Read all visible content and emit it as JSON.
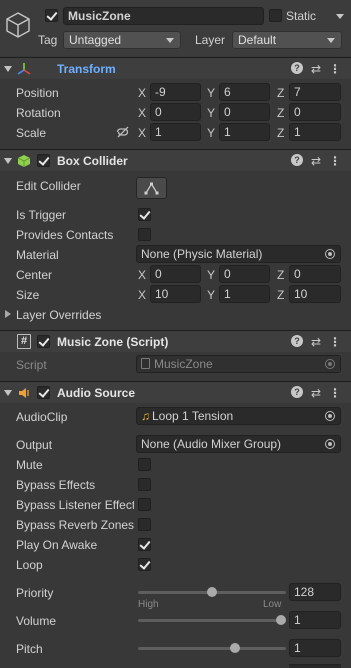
{
  "go": {
    "name": "MusicZone",
    "static_label": "Static",
    "tag_label": "Tag",
    "tag_value": "Untagged",
    "layer_label": "Layer",
    "layer_value": "Default"
  },
  "transform": {
    "title": "Transform",
    "rows": [
      {
        "label": "Position",
        "x": "-9",
        "y": "6",
        "z": "7"
      },
      {
        "label": "Rotation",
        "x": "0",
        "y": "0",
        "z": "0"
      },
      {
        "label": "Scale",
        "x": "1",
        "y": "1",
        "z": "1"
      }
    ]
  },
  "axes": {
    "x": "X",
    "y": "Y",
    "z": "Z"
  },
  "box_collider": {
    "title": "Box Collider",
    "edit_label": "Edit Collider",
    "is_trigger_label": "Is Trigger",
    "provides_contacts_label": "Provides Contacts",
    "material_label": "Material",
    "material_value": "None (Physic Material)",
    "center_label": "Center",
    "center": {
      "x": "0",
      "y": "0",
      "z": "0"
    },
    "size_label": "Size",
    "size": {
      "x": "10",
      "y": "1",
      "z": "10"
    },
    "layer_overrides_label": "Layer Overrides"
  },
  "script": {
    "title": "Music Zone (Script)",
    "label": "Script",
    "value": "MusicZone"
  },
  "audio": {
    "title": "Audio Source",
    "clip_label": "AudioClip",
    "clip_value": "Loop 1 Tension",
    "output_label": "Output",
    "output_value": "None (Audio Mixer Group)",
    "mute_label": "Mute",
    "bypass_effects_label": "Bypass Effects",
    "bypass_listener_label": "Bypass Listener Effects",
    "bypass_reverb_label": "Bypass Reverb Zones",
    "play_on_awake_label": "Play On Awake",
    "loop_label": "Loop",
    "priority_label": "Priority",
    "priority_value": "128",
    "priority_fraction": 0.5,
    "priority_high": "High",
    "priority_low": "Low",
    "volume_label": "Volume",
    "volume_value": "1",
    "volume_fraction": 1.0,
    "pitch_label": "Pitch",
    "pitch_value": "1",
    "pitch_fraction": 0.67
  },
  "colors": {
    "background": "#383838",
    "header": "#3e3e3e",
    "field": "#2a2a2a",
    "transform_title": "#6fb0ff",
    "axis_red": "#e2463a",
    "axis_green": "#7ed33a",
    "axis_blue": "#4b8df8",
    "collider_green": "#8fd14f",
    "audio_orange": "#f0a030"
  }
}
